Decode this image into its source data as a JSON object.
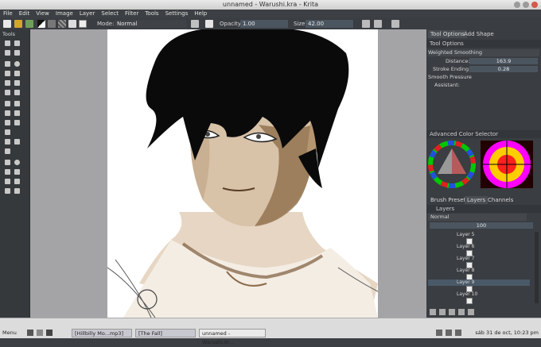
{
  "window": {
    "title": "unnamed - Warushi.kra - Krita"
  },
  "menubar": {
    "items": [
      "File",
      "Edit",
      "View",
      "Image",
      "Layer",
      "Select",
      "Filter",
      "Tools",
      "Settings",
      "Help"
    ]
  },
  "toolbar": {
    "mode_label": "Mode:",
    "mode_value": "Normal",
    "opacity_label": "Opacity:",
    "opacity_value": "1.00",
    "size_label": "Size:",
    "size_value": "42.00"
  },
  "toolbox": {
    "title": "Tools"
  },
  "dock": {
    "tabs": [
      "Tool Options",
      "Add Shape"
    ],
    "tool_options": {
      "header": "Tool Options",
      "smoothing": "Weighted Smoothing",
      "distance_label": "Distance:",
      "distance_value": "163.9",
      "stroke_ending_label": "Stroke Ending:",
      "stroke_ending_value": "0.28",
      "smooth_pressure_label": "Smooth Pressure",
      "assistant_label": "Assistant:"
    },
    "color_selector": {
      "header": "Advanced Color Selector"
    },
    "bottom_tabs": [
      "Brush Presets",
      "Layers",
      "Channels"
    ],
    "layers": {
      "header": "Layers",
      "blend_mode": "Normal",
      "opacity": "100",
      "items": [
        "Layer 5",
        "Layer 6",
        "Layer 7",
        "Layer 8",
        "Layer 9",
        "Layer 10"
      ]
    }
  },
  "taskbar": {
    "menu_label": "Menu",
    "tasks": [
      "[Hillbilly Mo...mp3]",
      "[The Fall]",
      "unnamed - Warushi.kr..."
    ],
    "clock": "sáb 31 de oct, 10:23 pm"
  },
  "colors": {
    "accent": "#4b5560",
    "panel": "#3a3d41",
    "canvas_bg": "#a4a4a6"
  }
}
